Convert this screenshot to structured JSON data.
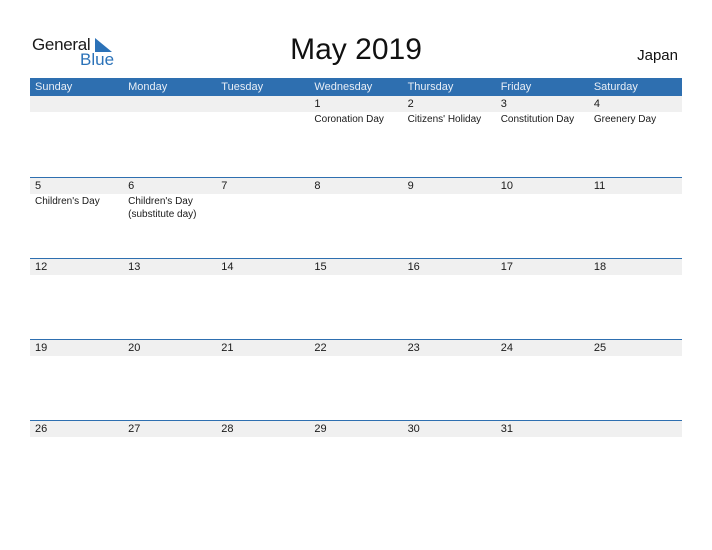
{
  "logo": {
    "line1": "General",
    "line2": "Blue"
  },
  "title": "May 2019",
  "country": "Japan",
  "colors": {
    "accent": "#2e6fb0",
    "band": "#f0f0f0"
  },
  "weekdays": [
    "Sunday",
    "Monday",
    "Tuesday",
    "Wednesday",
    "Thursday",
    "Friday",
    "Saturday"
  ],
  "weeks": [
    {
      "days": [
        "",
        "",
        "",
        "1",
        "2",
        "3",
        "4"
      ],
      "events": [
        "",
        "",
        "",
        "Coronation Day",
        "Citizens' Holiday",
        "Constitution Day",
        "Greenery Day"
      ]
    },
    {
      "days": [
        "5",
        "6",
        "7",
        "8",
        "9",
        "10",
        "11"
      ],
      "events": [
        "Children's Day",
        "Children's Day (substitute day)",
        "",
        "",
        "",
        "",
        ""
      ]
    },
    {
      "days": [
        "12",
        "13",
        "14",
        "15",
        "16",
        "17",
        "18"
      ],
      "events": [
        "",
        "",
        "",
        "",
        "",
        "",
        ""
      ]
    },
    {
      "days": [
        "19",
        "20",
        "21",
        "22",
        "23",
        "24",
        "25"
      ],
      "events": [
        "",
        "",
        "",
        "",
        "",
        "",
        ""
      ]
    },
    {
      "days": [
        "26",
        "27",
        "28",
        "29",
        "30",
        "31",
        ""
      ],
      "events": [
        "",
        "",
        "",
        "",
        "",
        "",
        ""
      ]
    }
  ]
}
